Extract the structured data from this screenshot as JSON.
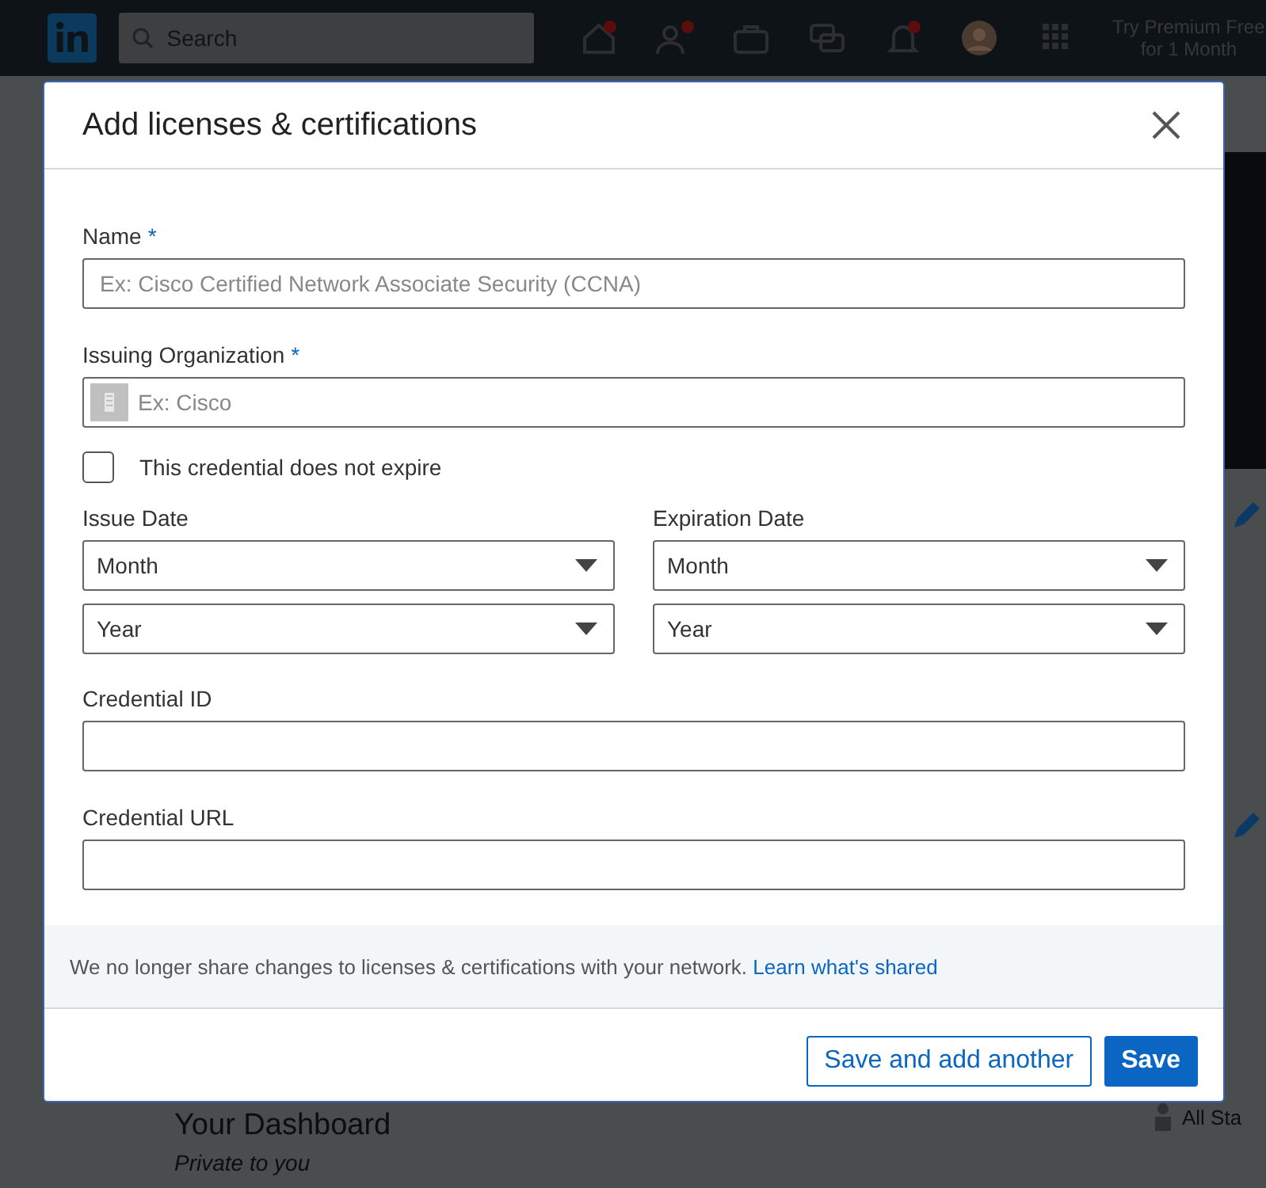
{
  "nav": {
    "search": {
      "placeholder": "Search"
    },
    "premium": "Try Premium Free for 1 Month"
  },
  "background": {
    "dashboard_title": "Your Dashboard",
    "dashboard_subtitle": "Private to you",
    "side_text": "All Sta"
  },
  "dialog": {
    "title": "Add licenses & certifications",
    "fields": [
      {
        "kind": "text",
        "label": "Name",
        "required_mark": "*",
        "placeholder": "Ex: Cisco Certified Network Associate Security (CCNA)"
      },
      {
        "kind": "org",
        "label": "Issuing Organization",
        "required_mark": "*",
        "placeholder": "Ex: Cisco"
      },
      {
        "kind": "checkbox",
        "label": "This credential does not expire",
        "checked": false
      },
      {
        "kind": "dates",
        "columns": [
          {
            "label": "Issue Date",
            "selects": [
              "Month",
              "Year"
            ]
          },
          {
            "label": "Expiration Date",
            "selects": [
              "Month",
              "Year"
            ]
          }
        ]
      },
      {
        "kind": "text",
        "label": "Credential ID"
      },
      {
        "kind": "text",
        "label": "Credential URL"
      }
    ],
    "notice": {
      "text": "We no longer share changes to licenses & certifications with your network.",
      "link": "Learn what's shared"
    },
    "buttons": [
      {
        "label": "Save and add another",
        "kind": "secondary"
      },
      {
        "label": "Save",
        "kind": "primary"
      }
    ]
  }
}
